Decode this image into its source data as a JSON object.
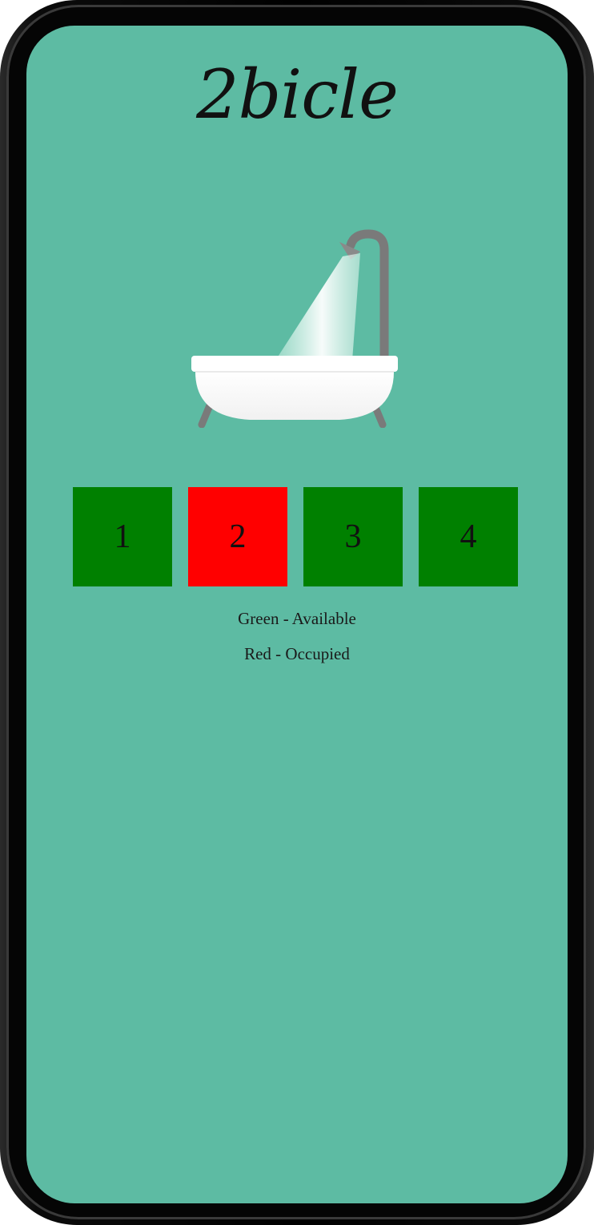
{
  "app": {
    "title": "2bicle"
  },
  "illustration": {
    "icon": "bathtub-shower-icon"
  },
  "stalls": [
    {
      "label": "1",
      "status": "available",
      "color": "#008000"
    },
    {
      "label": "2",
      "status": "occupied",
      "color": "#ff0000"
    },
    {
      "label": "3",
      "status": "available",
      "color": "#008000"
    },
    {
      "label": "4",
      "status": "available",
      "color": "#008000"
    }
  ],
  "legend": {
    "available": "Green - Available",
    "occupied": "Red - Occupied"
  },
  "colors": {
    "screen_background": "#5dbba3",
    "available": "#008000",
    "occupied": "#ff0000"
  }
}
